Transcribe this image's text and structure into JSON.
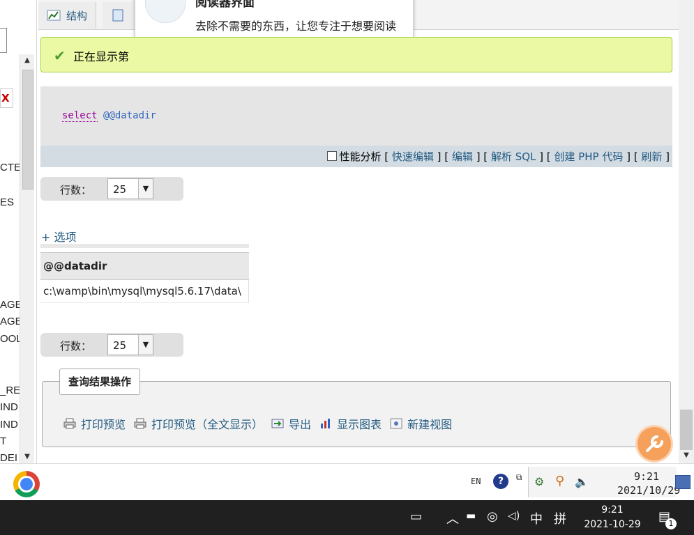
{
  "left_panel": {
    "fragments": [
      "X",
      "CTE",
      "ES",
      "AGE",
      "AGE_",
      "OOL",
      "_RES",
      "IND",
      "IND",
      "T",
      "DEI"
    ]
  },
  "tabs": [
    {
      "label": "结构",
      "icon": "table-structure-icon"
    },
    {
      "label": "",
      "icon": "sql-icon"
    }
  ],
  "reader_popup": {
    "title": "阅读器界面",
    "body": "去除不需要的东西，让您专注于想要阅读的内容。"
  },
  "notice": {
    "text": "正在显示第"
  },
  "sql": {
    "keyword": "select",
    "variable": "@@datadir",
    "profiling_label": "性能分析",
    "links": [
      "快速编辑",
      "编辑",
      "解析 SQL",
      "创建 PHP 代码",
      "刷新"
    ]
  },
  "rows_top": {
    "label": "行数：",
    "value": "25"
  },
  "options_link": "+ 选项",
  "result": {
    "column": "@@datadir",
    "value": "c:\\wamp\\bin\\mysql\\mysql5.6.17\\data\\"
  },
  "rows_bottom": {
    "label": "行数：",
    "value": "25"
  },
  "query_ops": {
    "legend": "查询结果操作",
    "items": [
      {
        "label": "打印预览",
        "icon": "printer-icon"
      },
      {
        "label": "打印预览（全文显示）",
        "icon": "printer-icon"
      },
      {
        "label": "导出",
        "icon": "export-icon"
      },
      {
        "label": "显示图表",
        "icon": "chart-icon"
      },
      {
        "label": "新建视图",
        "icon": "view-icon"
      }
    ]
  },
  "vm_taskbar": {
    "lang": "EN",
    "time": "9:21",
    "date": "2021/10/29"
  },
  "host_taskbar": {
    "ime_mode": "中",
    "ime_name": "拼",
    "time": "9:21",
    "date": "2021-10-29",
    "notification_count": "1"
  }
}
